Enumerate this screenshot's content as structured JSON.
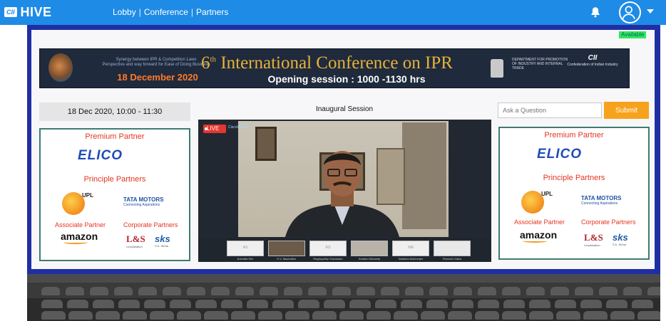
{
  "header": {
    "logo_cii": "CII",
    "logo_hive": "HIVE",
    "nav": [
      "Lobby",
      "Conference",
      "Partners"
    ],
    "nav_sep": "|"
  },
  "status": {
    "available": "Available"
  },
  "banner": {
    "synergy_line1": "Synergy between IPR & Competition Laws",
    "synergy_line2": "Perspective and way forward for Ease of Doing Business",
    "date": "18 December 2020",
    "title_num": "6",
    "title_sup": "th",
    "title_rest": " International Conference on IPR",
    "subtitle": "Opening session : 1000 -1130 hrs",
    "dpiit": "DEPARTMENT FOR PROMOTION OF INDUSTRY AND INTERNAL TRADE",
    "cii_mark": "CII",
    "cii_text": "Confederation of Indian Industry"
  },
  "session": {
    "datetime": "18 Dec 2020, 10:00 - 11:30",
    "title": "Inaugural Session",
    "live_label": "LIVE",
    "webex_label": "CiscoWebex",
    "participants": [
      {
        "initials": "AS",
        "name": "Anindita Sen"
      },
      {
        "initials": "",
        "name": "K.V. Mazhathur"
      },
      {
        "initials": "RS",
        "name": "Raghupathy Sundaram"
      },
      {
        "initials": "",
        "name": "Kantam Mohanty"
      },
      {
        "initials": "NM",
        "name": "Natasha Mukherjee"
      },
      {
        "initials": "",
        "name": "Rumesh Gatra"
      }
    ]
  },
  "question": {
    "placeholder": "Ask a Question",
    "submit_label": "Submit"
  },
  "partners": {
    "premium_label": "Premium Partner",
    "premium_name": "ELICO",
    "principle_label": "Principle Partners",
    "upl": "UPL",
    "tata": "TATA MOTORS",
    "tata_tag": "Connecting Aspirations",
    "associate_label": "Associate Partner",
    "amazon": "amazon",
    "corporate_label": "Corporate Partners",
    "ls": "L&S",
    "ls_tag": "Lexplanation",
    "sks": "sks",
    "sks_tag": "S.K. Sinha"
  },
  "colors": {
    "topbar": "#1e8be6",
    "stage_frame": "#1f2fa3",
    "accent_red": "#e53420",
    "submit": "#f7a21c",
    "available": "#32e85e"
  }
}
